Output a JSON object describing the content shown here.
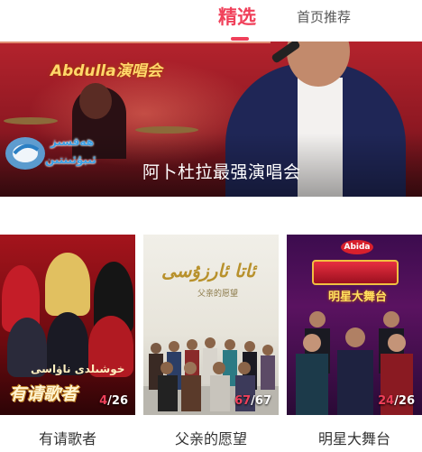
{
  "tabs": {
    "active": "精选",
    "inactive": "首页推荐"
  },
  "banner": {
    "brand_text": "Abdulla演唱会",
    "title": "阿卜杜拉最强演唱会",
    "watermark_line1": "ھەقسىز",
    "watermark_line2": "ئىبۇئىنتىن"
  },
  "cards": [
    {
      "caption": "有请歌者",
      "poster_title": "有请歌者",
      "poster_subtitle": "خوشىلدى ناۋاسى",
      "episode_current": "4",
      "episode_total": "/26"
    },
    {
      "caption": "父亲的愿望",
      "poster_title": "ئاتا ئارزۇسى",
      "poster_subtitle": "父亲的愿望",
      "episode_current": "67",
      "episode_total": "/67"
    },
    {
      "caption": "明星大舞台",
      "poster_logo": "Abida",
      "poster_subtitle": "明星大舞台",
      "episode_current": "24",
      "episode_total": "/26"
    }
  ],
  "colors": {
    "accent": "#f0405a",
    "tab_inactive": "#555555",
    "caption": "#333333"
  }
}
